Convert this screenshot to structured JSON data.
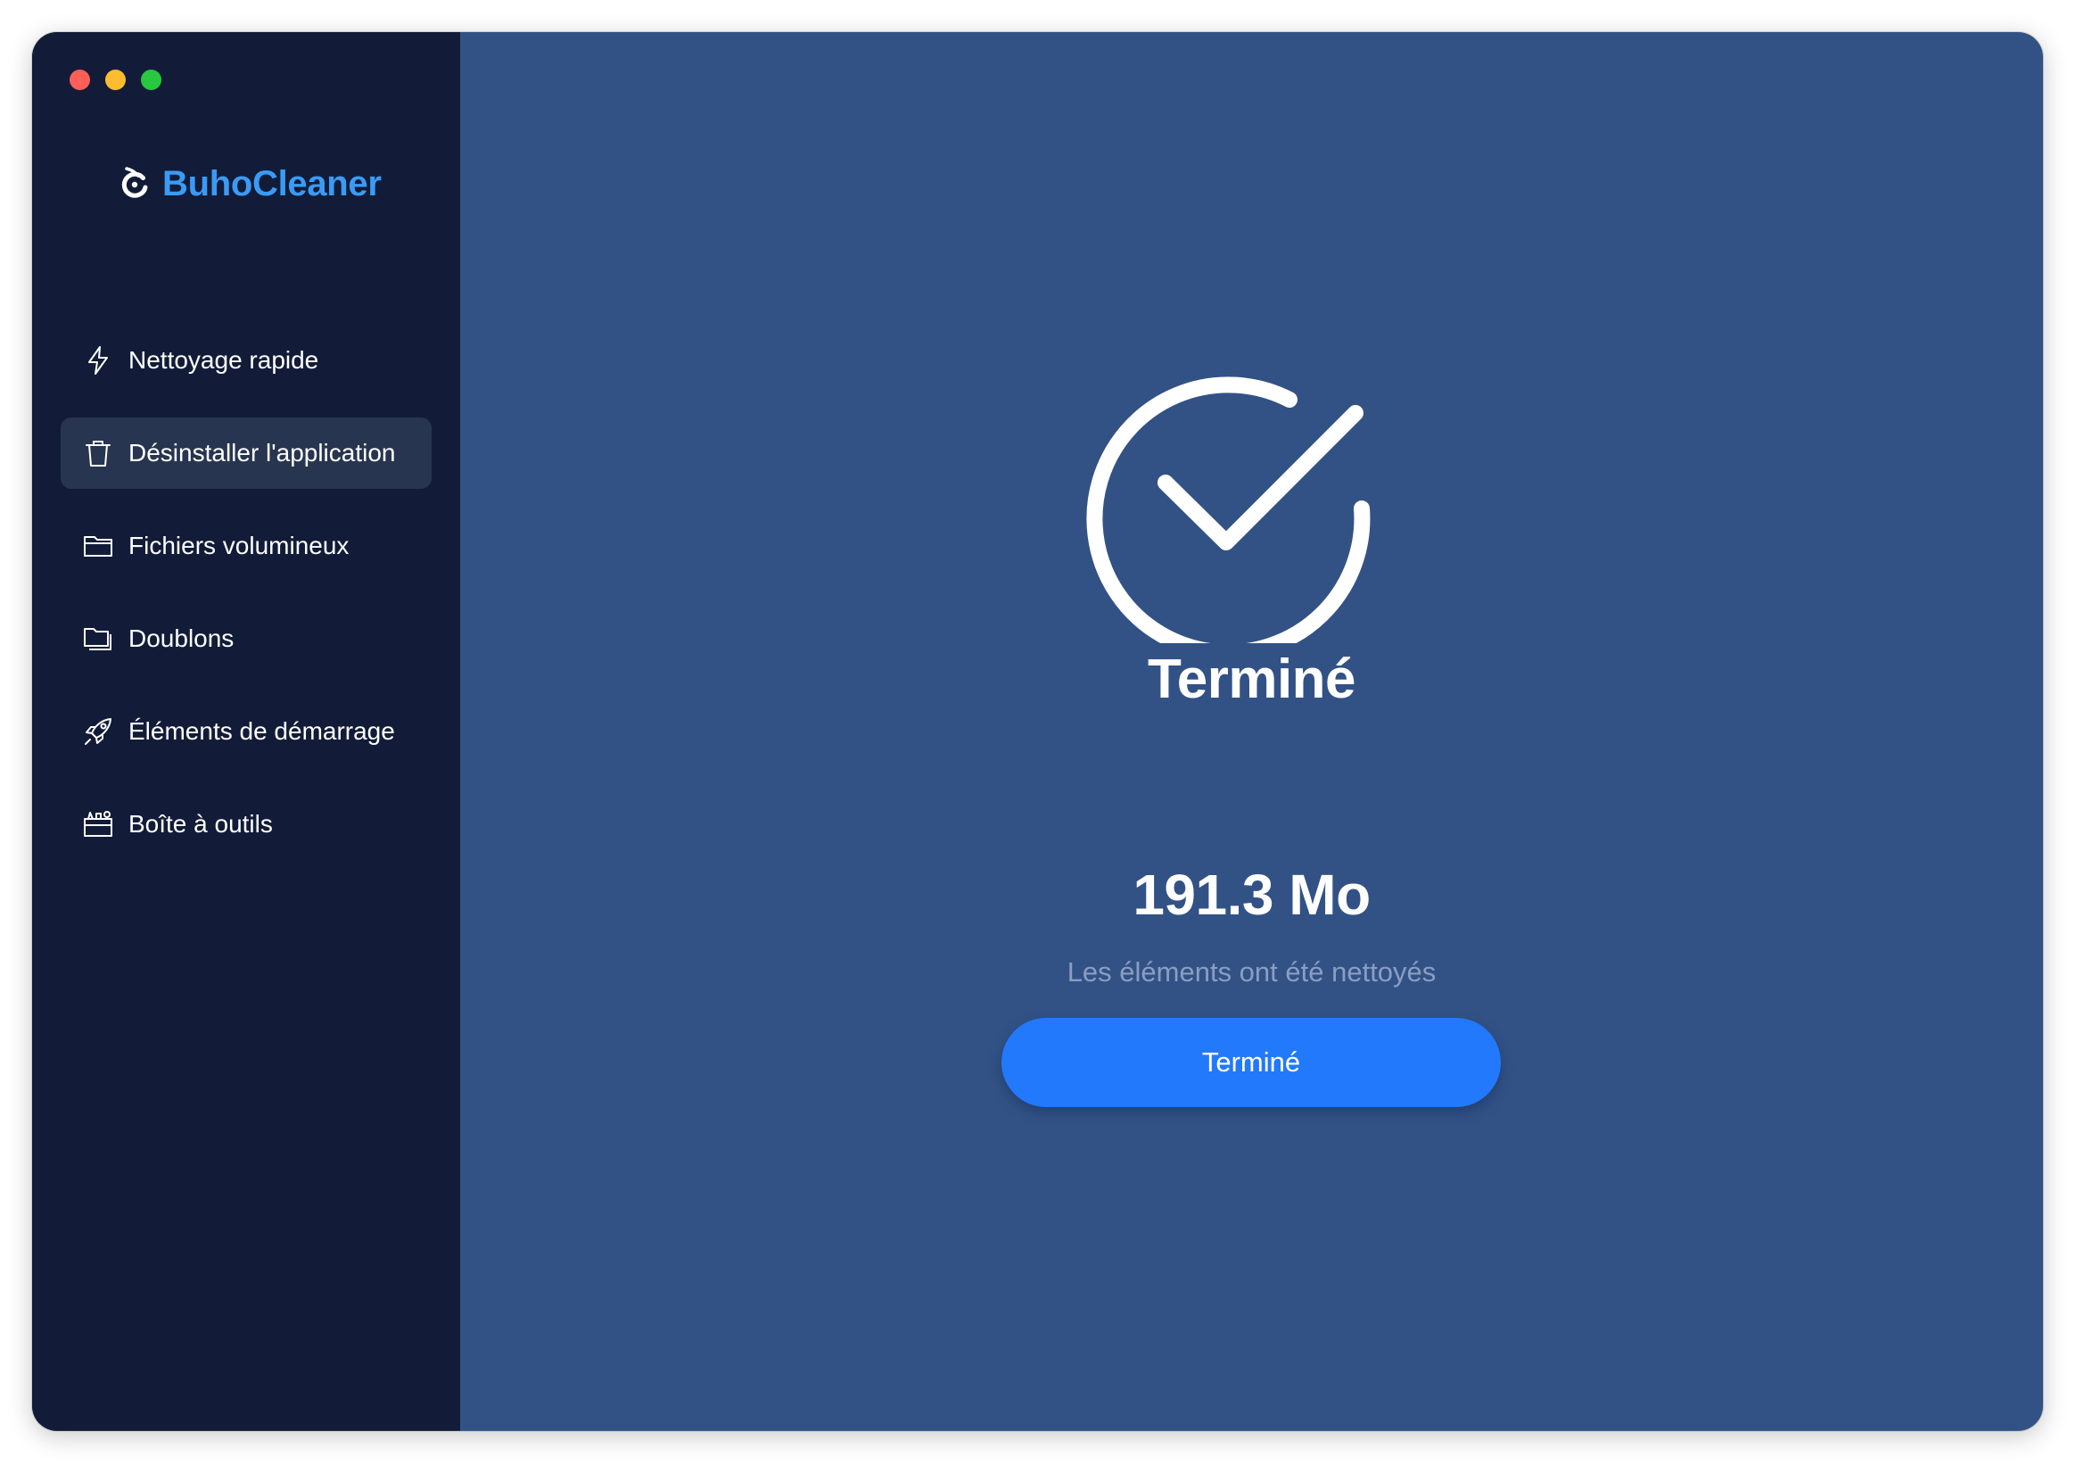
{
  "app": {
    "name": "BuhoCleaner",
    "brand_color": "#3a9bf5"
  },
  "window_controls": [
    {
      "name": "close",
      "color": "#fe5f57"
    },
    {
      "name": "minimize",
      "color": "#febc2e"
    },
    {
      "name": "zoom",
      "color": "#28c840"
    }
  ],
  "sidebar": {
    "items": [
      {
        "label": "Nettoyage rapide",
        "icon": "lightning-icon",
        "active": false
      },
      {
        "label": "Désinstaller l'application",
        "icon": "trash-icon",
        "active": true
      },
      {
        "label": "Fichiers volumineux",
        "icon": "folder-icon",
        "active": false
      },
      {
        "label": "Doublons",
        "icon": "duplicate-folders-icon",
        "active": false
      },
      {
        "label": "Éléments de démarrage",
        "icon": "rocket-icon",
        "active": false
      },
      {
        "label": "Boîte à outils",
        "icon": "toolbox-icon",
        "active": false
      }
    ]
  },
  "main": {
    "status_icon": "checkmark-circle-icon",
    "title": "Terminé",
    "size_value": "191.3 Mo",
    "size_caption": "Les éléments ont été nettoyés",
    "button_label": "Terminé",
    "button_color": "#2279fb"
  }
}
